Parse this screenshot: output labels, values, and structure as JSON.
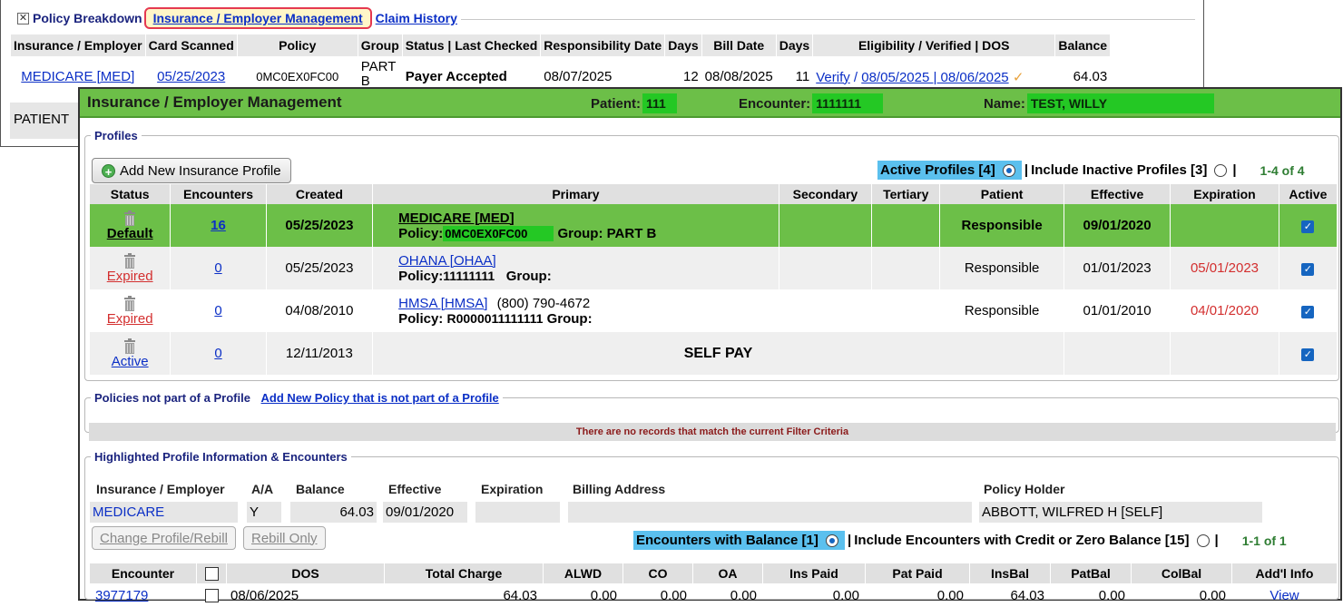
{
  "bg": {
    "tabs": {
      "policy_breakdown": "Policy Breakdown",
      "insurance_employer_mgmt": "Insurance / Employer Management",
      "claim_history": "Claim History"
    },
    "columns": [
      "Insurance / Employer",
      "Card Scanned",
      "Policy",
      "Group",
      "Status | Last Checked",
      "Responsibility Date",
      "Days",
      "Bill Date",
      "Days",
      "Eligibility / Verified | DOS",
      "Balance"
    ],
    "row": {
      "insurance": "MEDICARE [MED]",
      "card_scanned": "05/25/2023",
      "policy": "0MC0EX0FC00",
      "group": "PART B",
      "status": "Payer Accepted",
      "responsibility_date": "08/07/2025",
      "days1": "12",
      "bill_date": "08/08/2025",
      "days2": "11",
      "verify": "Verify",
      "sep": "/",
      "verified_dos": "08/05/2025 | 08/06/2025",
      "balance": "64.03"
    },
    "patient_label": "PATIENT"
  },
  "header": {
    "title": "Insurance / Employer Management",
    "patient_label": "Patient:",
    "patient_value": "111",
    "encounter_label": "Encounter:",
    "encounter_value": "1111111",
    "name_label": "Name:",
    "name_value": "TEST, WILLY"
  },
  "profiles": {
    "legend": "Profiles",
    "add_button": "Add New Insurance Profile",
    "active_filter": "Active Profiles [4]",
    "sep": "|",
    "inactive_filter": "Include Inactive Profiles [3]",
    "sep2": "|",
    "count": "1-4 of 4",
    "columns": [
      "Status",
      "Encounters",
      "Created",
      "Primary",
      "Secondary",
      "Tertiary",
      "Patient",
      "Effective",
      "Expiration",
      "Active"
    ],
    "rows": [
      {
        "status": "Default",
        "encounters": "16",
        "created": "05/25/2023",
        "primary_name": "MEDICARE [MED]",
        "policy_label": "Policy:",
        "policy": "0MC0EX0FC00",
        "group_label": "Group:",
        "group": "PART B",
        "patient": "Responsible",
        "effective": "09/01/2020",
        "expiration": ""
      },
      {
        "status": "Expired",
        "encounters": "0",
        "created": "05/25/2023",
        "primary_name": "OHANA [OHAA]",
        "policy_label": "Policy:",
        "policy": "11111111",
        "group_label": "Group:",
        "group": "",
        "patient": "Responsible",
        "effective": "01/01/2023",
        "expiration": "05/01/2023"
      },
      {
        "status": "Expired",
        "encounters": "0",
        "created": "04/08/2010",
        "primary_name": "HMSA [HMSA]",
        "phone": "(800) 790-4672",
        "policy_label": "Policy:",
        "policy": "R0000011111111",
        "group_label": "Group:",
        "group": "",
        "patient": "Responsible",
        "effective": "01/01/2010",
        "expiration": "04/01/2020"
      },
      {
        "status": "Active",
        "encounters": "0",
        "created": "12/11/2013",
        "primary_name": "SELF PAY"
      }
    ]
  },
  "nonprofile": {
    "legend": "Policies not part of a Profile",
    "add_link": "Add New Policy that is not part of a Profile",
    "message": "There are no records that match the current Filter Criteria"
  },
  "highlight": {
    "legend": "Highlighted Profile Information & Encounters",
    "labels": {
      "insurance": "Insurance / Employer",
      "aa": "A/A",
      "balance": "Balance",
      "effective": "Effective",
      "expiration": "Expiration",
      "billing": "Billing Address",
      "holder": "Policy Holder"
    },
    "values": {
      "insurance": "MEDICARE",
      "aa": "Y",
      "balance": "64.03",
      "effective": "09/01/2020",
      "expiration": "",
      "billing": "",
      "holder": "ABBOTT, WILFRED H [SELF]"
    },
    "change_button": "Change Profile/Rebill",
    "rebill_button": "Rebill Only",
    "enc_filter": "Encounters with Balance [1]",
    "sep": "|",
    "enc_all_filter": "Include Encounters with Credit or Zero Balance [15]",
    "sep2": "|",
    "count": "1-1 of 1",
    "columns": [
      "Encounter",
      "",
      "DOS",
      "Total Charge",
      "ALWD",
      "CO",
      "OA",
      "Ins Paid",
      "Pat Paid",
      "InsBal",
      "PatBal",
      "ColBal",
      "Add'l Info"
    ],
    "row": {
      "encounter": "3977179",
      "dos": "08/06/2025",
      "total": "64.03",
      "alwd": "0.00",
      "co": "0.00",
      "oa": "0.00",
      "ins_paid": "0.00",
      "pat_paid": "0.00",
      "insbal": "64.03",
      "patbal": "0.00",
      "colbal": "0.00",
      "info": "View"
    }
  },
  "colors": {
    "header_green": "#6cbf48",
    "highlight_green": "#24c824",
    "link_blue": "#0b2fc6",
    "expired_red": "#d32f2f",
    "filter_blue": "#5bc0ee"
  }
}
